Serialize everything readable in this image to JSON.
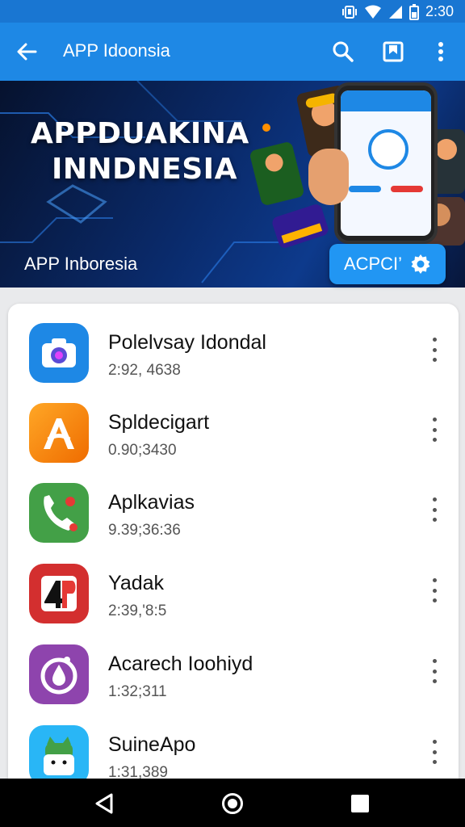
{
  "status_bar": {
    "time": "2:30"
  },
  "app_bar": {
    "title": "APP Idoonsia",
    "back_icon": "arrow-back-icon",
    "actions": [
      "search-icon",
      "bookmark-icon",
      "more-vert-icon"
    ]
  },
  "banner": {
    "title_line1": "APPDUAKINA",
    "title_line2": "INNDNESIA",
    "subtitle": "APP Inboresia",
    "cta_label": "ACPCI’",
    "cta_icon": "gear-icon"
  },
  "apps": [
    {
      "name": "Polelvsay Idondal",
      "meta": "2:92, 4638",
      "icon": "camera-icon",
      "color": "#1e88e5"
    },
    {
      "name": "Spldecigart",
      "meta": "0.90;3430",
      "icon": "letter-a-icon",
      "color": "#fb8c00"
    },
    {
      "name": "Aplkavias",
      "meta": "9.39;36:36",
      "icon": "phone-icon",
      "color": "#43a047"
    },
    {
      "name": "Yadak",
      "meta": "2:39,'8:5",
      "icon": "4p-logo-icon",
      "color": "#e53935"
    },
    {
      "name": "Acarech Ioohiyd",
      "meta": "1:32;311",
      "icon": "drop-icon",
      "color": "#8e44ad"
    },
    {
      "name": "SuineApo",
      "meta": "1:31,389",
      "icon": "android-icon",
      "color": "#29b6f6"
    }
  ],
  "nav_bar": {
    "buttons": [
      "back-triangle-icon",
      "home-circle-icon",
      "recents-square-icon"
    ]
  },
  "colors": {
    "primary": "#1e88e5",
    "status": "#1976d2",
    "nav": "#000000"
  }
}
